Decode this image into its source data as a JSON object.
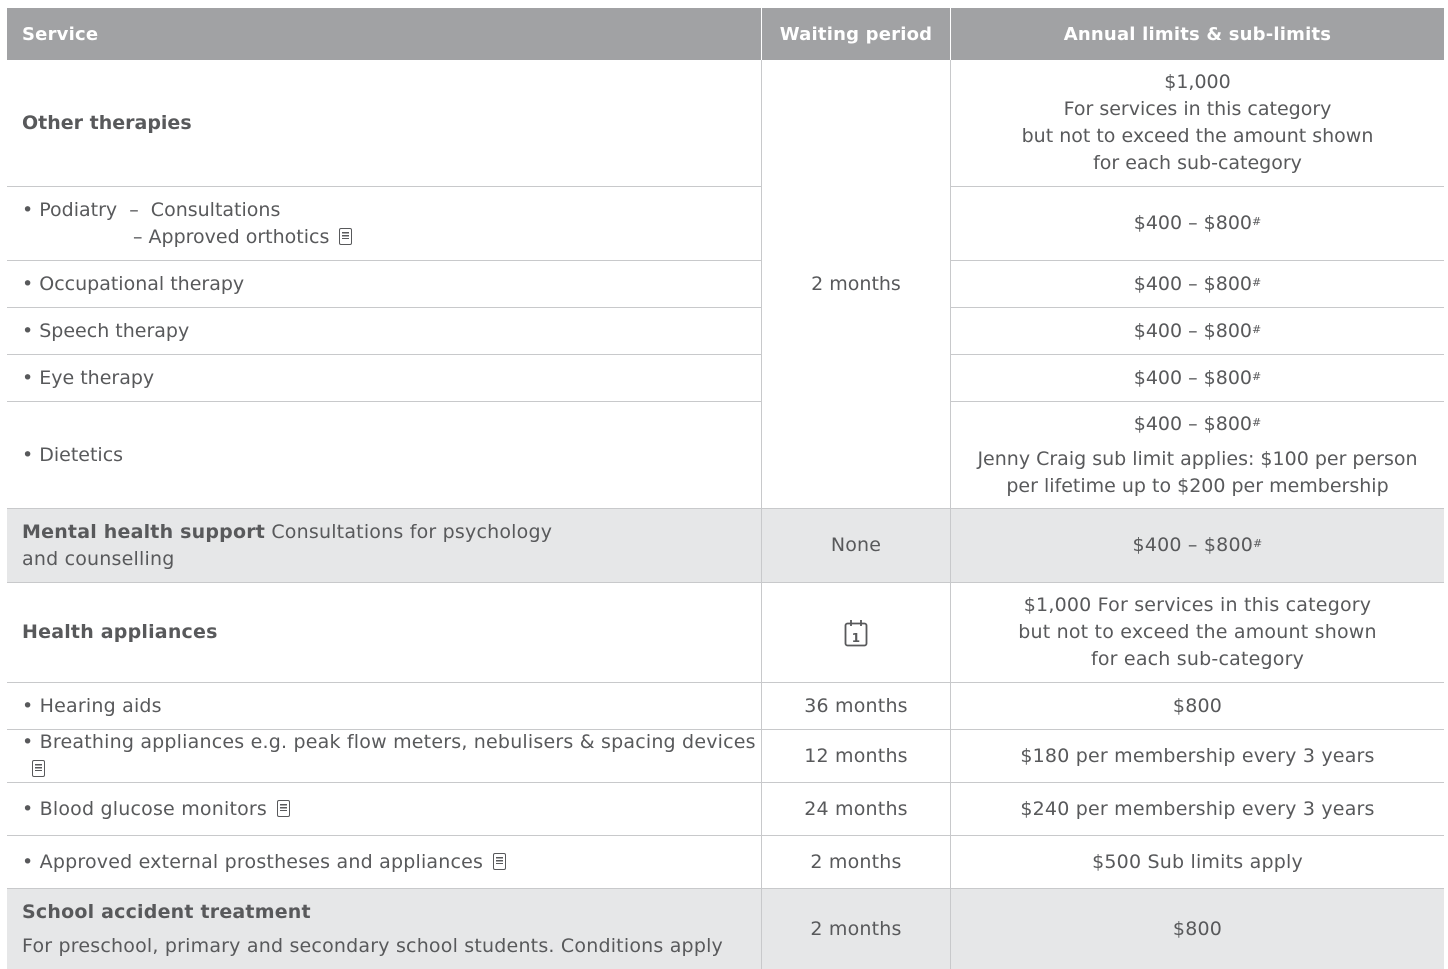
{
  "header": {
    "service": "Service",
    "waiting": "Waiting period",
    "limits": "Annual limits & sub-limits"
  },
  "other_therapies": {
    "label": "Other therapies",
    "waiting": "2 months",
    "limit_lines": [
      "$1,000",
      "For services in this category",
      "but not to exceed the amount shown",
      "for each sub-category"
    ],
    "podiatry": {
      "line1": "• Podiatry  –  Consultations",
      "line2": "–  Approved orthotics",
      "limit": "$400 – $800"
    },
    "occupational": {
      "label": "• Occupational therapy",
      "limit": "$400 – $800"
    },
    "speech": {
      "label": "• Speech therapy",
      "limit": "$400 – $800"
    },
    "eye": {
      "label": "• Eye therapy",
      "limit": "$400 – $800"
    },
    "dietetics": {
      "label": "• Dietetics",
      "limit": "$400 – $800",
      "note_lines": [
        "Jenny Craig sub limit applies: $100 per person",
        "per lifetime up to $200 per membership"
      ]
    },
    "hash": "#"
  },
  "mental_health": {
    "label_bold": "Mental health support",
    "label_rest": " Consultations for psychology",
    "label_line2": "and counselling",
    "waiting": "None",
    "limit": "$400 – $800",
    "hash": "#"
  },
  "health_appliances": {
    "label": "Health appliances",
    "waiting_icon": "calendar-icon",
    "waiting_icon_text": "1",
    "limit_lines": [
      "$1,000 For services in this category",
      "but not to exceed the amount shown",
      "for each sub-category"
    ]
  },
  "rows": [
    {
      "label": "• Hearing aids",
      "doc": false,
      "waiting": "36 months",
      "limit": "$800"
    },
    {
      "label": "• Breathing appliances e.g. peak flow meters, nebulisers & spacing devices",
      "doc": true,
      "waiting": "12 months",
      "limit": "$180 per membership every 3 years"
    },
    {
      "label": "• Blood glucose monitors",
      "doc": true,
      "waiting": "24 months",
      "limit": "$240 per membership every 3 years"
    },
    {
      "label": "• Approved external prostheses and appliances",
      "doc": true,
      "waiting": "2 months",
      "limit": "$500 Sub limits apply"
    }
  ],
  "school": {
    "label": "School accident treatment",
    "desc": "For preschool, primary and secondary school students. Conditions apply",
    "waiting": "2 months",
    "limit": "$800"
  },
  "icons": {
    "doc": "document-icon",
    "calendar": "calendar-icon"
  },
  "colors": {
    "header_bg": "#a1a2a4",
    "shade_bg": "#e6e7e8",
    "text": "#58595b"
  }
}
